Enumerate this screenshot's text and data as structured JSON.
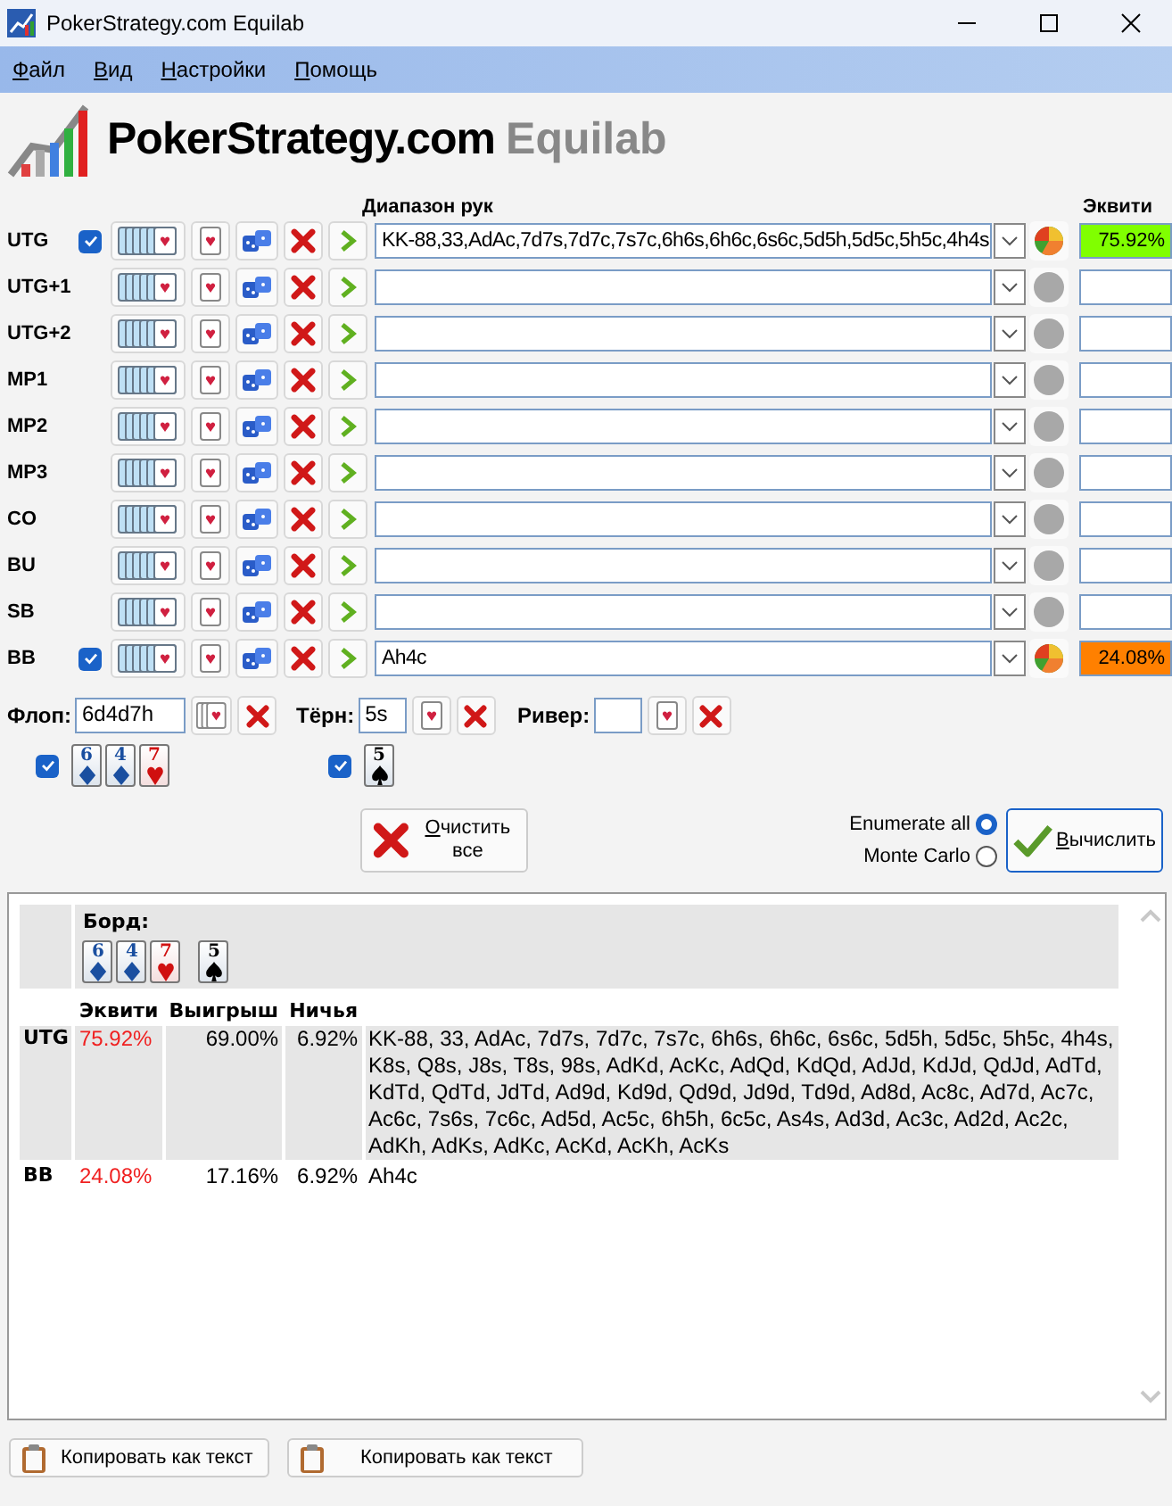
{
  "window": {
    "title": "PokerStrategy.com Equilab"
  },
  "menu": [
    "Файл",
    "Вид",
    "Настройки",
    "Помощь"
  ],
  "logo": {
    "brand": "PokerStrategy.com",
    "product": "Equilab"
  },
  "columns": {
    "range": "Диапазон рук",
    "equity": "Эквити"
  },
  "players": [
    {
      "name": "UTG",
      "checked": true,
      "range": "KK-88,33,AdAc,7d7s,7d7c,7s7c,6h6s,6h6c,6s6c,5d5h,5d5c,5h5c,4h4s",
      "equity": "75.92%",
      "color": "#80ff00"
    },
    {
      "name": "UTG+1",
      "checked": false
    },
    {
      "name": "UTG+2",
      "checked": false
    },
    {
      "name": "MP1",
      "checked": false
    },
    {
      "name": "MP2",
      "checked": false
    },
    {
      "name": "MP3",
      "checked": false
    },
    {
      "name": "CO",
      "checked": false
    },
    {
      "name": "BU",
      "checked": false
    },
    {
      "name": "SB",
      "checked": false
    },
    {
      "name": "BB",
      "checked": true,
      "range": "Ah4c",
      "equity": "24.08%",
      "color": "#ff8000"
    }
  ],
  "board": {
    "flop": {
      "label": "Флоп:",
      "value": "6d4d7h",
      "checked": true,
      "cards": [
        {
          "rank": "6",
          "kind": "diamond"
        },
        {
          "rank": "4",
          "kind": "diamond"
        },
        {
          "rank": "7",
          "kind": "heart"
        }
      ]
    },
    "turn": {
      "label": "Тёрн:",
      "value": "5s",
      "checked": true,
      "cards": [
        {
          "rank": "5",
          "kind": "spade"
        }
      ]
    },
    "river": {
      "label": "Ривер:"
    }
  },
  "clear_button": "Очистить все",
  "modes": [
    {
      "label": "Enumerate all",
      "selected": true
    },
    {
      "label": "Monte Carlo",
      "selected": false
    }
  ],
  "calculate_button": "Вычислить",
  "results": {
    "board_label": "Борд:",
    "cards": [
      {
        "rank": "6",
        "kind": "diamond"
      },
      {
        "rank": "4",
        "kind": "diamond"
      },
      {
        "rank": "7",
        "kind": "heart"
      },
      {
        "rank": "5",
        "kind": "spade"
      }
    ],
    "columns": [
      "Эквити",
      "Выигрыш",
      "Ничья"
    ],
    "rows": [
      {
        "player": "UTG",
        "equity": "75.92%",
        "win": "69.00%",
        "tie": "6.92%",
        "hands": "KK-88, 33, AdAc, 7d7s, 7d7c, 7s7c, 6h6s, 6h6c, 6s6c, 5d5h, 5d5c, 5h5c, 4h4s, K8s, Q8s, J8s, T8s, 98s, AdKd, AcKc, AdQd, KdQd, AdJd, KdJd, QdJd, AdTd, KdTd, QdTd, JdTd, Ad9d, Kd9d, Qd9d, Jd9d, Td9d, Ad8d, Ac8c, Ad7d, Ac7c, Ac6c, 7s6s, 7c6c, Ad5d, Ac5c, 6h5h, 6c5c, As4s, Ad3d, Ac3c, Ad2d, Ac2c, AdKh, AdKs, AdKc, AcKd, AcKh, AcKs"
      },
      {
        "player": "BB",
        "equity": "24.08%",
        "win": "17.16%",
        "tie": "6.92%",
        "hands": "Ah4c"
      }
    ]
  },
  "copy_buttons": [
    "Копировать как текст",
    "Копировать как текст"
  ]
}
